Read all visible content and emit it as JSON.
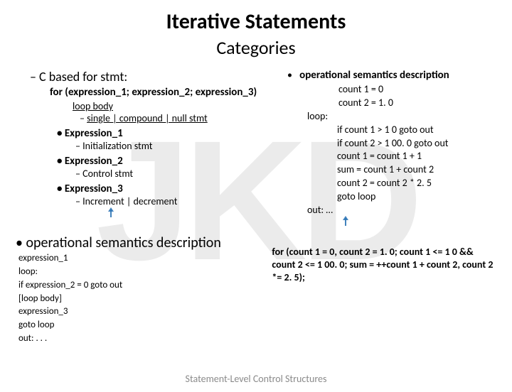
{
  "watermark": "JKD",
  "title": "Iterative Statements",
  "subtitle": "Categories",
  "left": {
    "bullet_dash": "–  C based for stmt:",
    "for_line": "for (expression_1; expression_2; expression_3)",
    "loop_body": "loop body",
    "loop_body_sub_dash": "–  ",
    "loop_body_sub": "single | compound | null stmt",
    "expr1": "•  Expression_1",
    "expr1_sub": "–  Initialization stmt",
    "expr2": "•  Expression_2",
    "expr2_sub": "–  Control stmt",
    "expr3": "•  Expression_3",
    "expr3_sub": "–  Increment | decrement"
  },
  "right": {
    "hdr_bullet": "•",
    "hdr": "operational semantics description",
    "line1": "count 1 = 0",
    "line2": "count 2 = 1. 0",
    "loop_label": "loop:",
    "b1": "if count 1 > 1 0 goto out",
    "b2": "if count 2 > 1 00. 0 goto out",
    "b3": "count 1 = count 1 + 1",
    "b4": "sum = count 1 + count 2",
    "b5": "count 2 = count 2 * 2. 5",
    "b6": "goto loop",
    "out_label": "out: …"
  },
  "bottom": {
    "hdr": "•  operational semantics description",
    "l1": "expression_1",
    "l2": "loop:",
    "l3": "if expression_2 = 0 goto out",
    "l4": "[loop body]",
    "l5": "expression_3",
    "l6": "goto loop",
    "l7": "out: . . ."
  },
  "for_example": "for (count 1 = 0, count 2 = 1. 0; count 1 <= 1 0 && count 2 <= 1 00. 0; sum = ++count 1 + count 2, count 2 *= 2. 5);",
  "footer": "Statement-Level Control Structures"
}
